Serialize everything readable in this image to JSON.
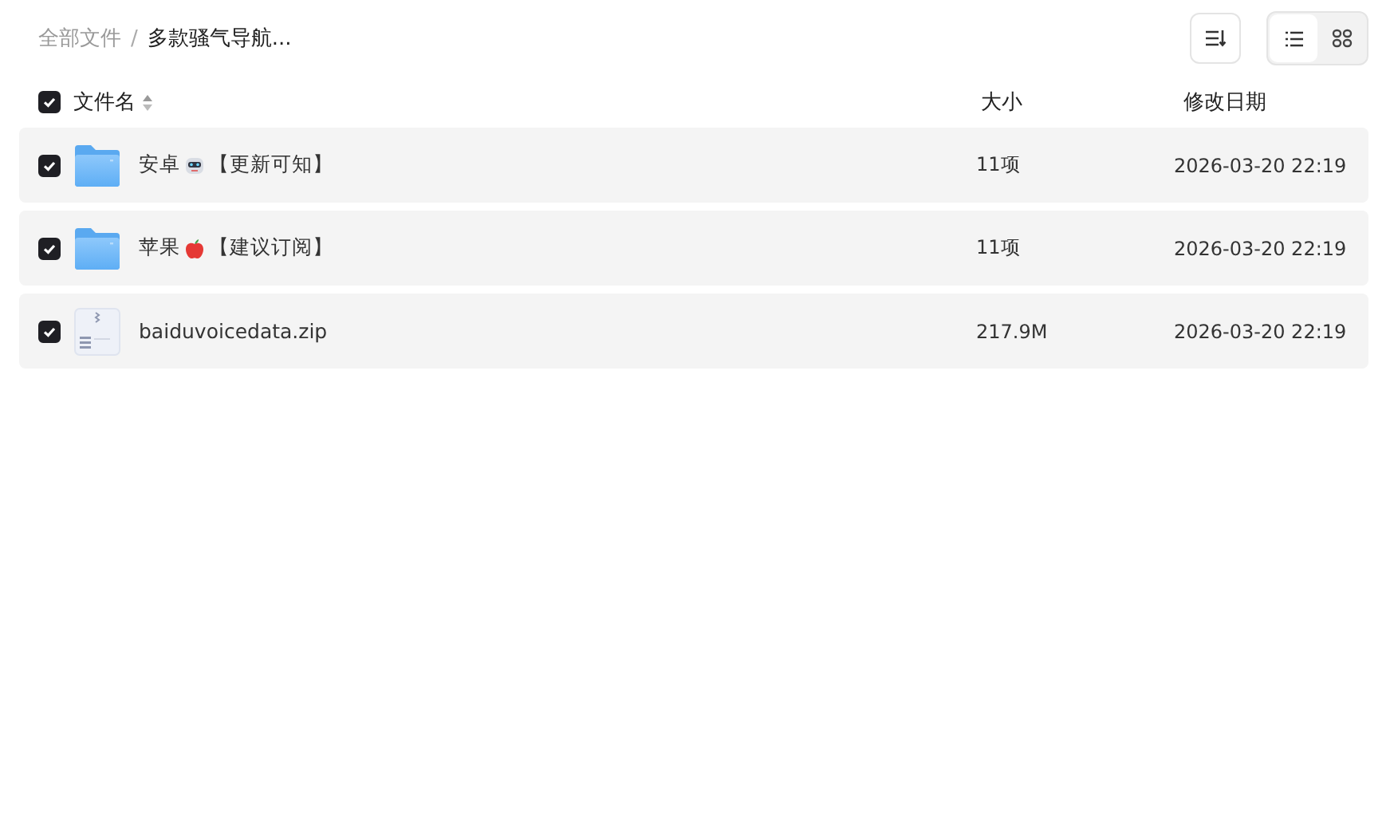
{
  "breadcrumb_separator": "/",
  "breadcrumb": [
    {
      "label": "全部文件",
      "current": false
    },
    {
      "label": "多款骚气导航...",
      "current": true
    }
  ],
  "view_modes": [
    {
      "kind": "list",
      "selected": true
    },
    {
      "kind": "grid",
      "selected": false
    }
  ],
  "table": {
    "all_checked": true,
    "columns": [
      "文件名",
      "大小",
      "修改日期"
    ],
    "rows": [
      {
        "kind": "folder",
        "checked": true,
        "name": "安卓",
        "emoji": {
          "kind": "robot"
        },
        "tag": "【更新可知】",
        "size": "11项",
        "date": "2026-03-20 22:19"
      },
      {
        "kind": "folder",
        "checked": true,
        "name": "苹果",
        "emoji": {
          "kind": "apple"
        },
        "tag": "【建议订阅】",
        "size": "11项",
        "date": "2026-03-20 22:19"
      },
      {
        "kind": "zip",
        "checked": true,
        "name": "baiduvoicedata.zip",
        "size": "217.9M",
        "date": "2026-03-20 22:19"
      }
    ]
  }
}
